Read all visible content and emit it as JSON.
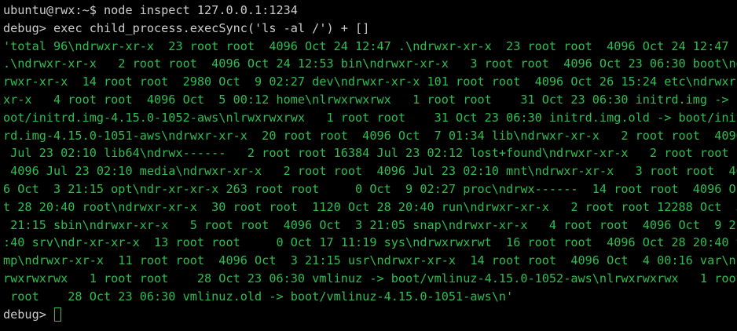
{
  "terminal": {
    "shell_prompt": "ubuntu@rwx:~$ ",
    "shell_command": "node inspect 127.0.0.1:1234",
    "debug_prompt": "debug> ",
    "debug_command": "exec child_process.execSync('ls -al /') + []",
    "output_lines": [
      "'total 96\\ndrwxr-xr-x  23 root root  4096 Oct 24 12:47 .\\ndrwxr-xr-x  23 root root  4096 Oct 24 12:47 .",
      ".\\ndrwxr-xr-x   2 root root  4096 Oct 24 12:53 bin\\ndrwxr-xr-x   3 root root  4096 Oct 23 06:30 boot\\nd",
      "rwxr-xr-x  14 root root  2980 Oct  9 02:27 dev\\ndrwxr-xr-x 101 root root  4096 Oct 26 15:24 etc\\ndrwxr-",
      "xr-x   4 root root  4096 Oct  5 00:12 home\\nlrwxrwxrwx   1 root root    31 Oct 23 06:30 initrd.img -> b",
      "oot/initrd.img-4.15.0-1052-aws\\nlrwxrwxrwx   1 root root    31 Oct 23 06:30 initrd.img.old -> boot/init",
      "rd.img-4.15.0-1051-aws\\ndrwxr-xr-x  20 root root  4096 Oct  7 01:34 lib\\ndrwxr-xr-x   2 root root  4096",
      " Jul 23 02:10 lib64\\ndrwx------   2 root root 16384 Jul 23 02:12 lost+found\\ndrwxr-xr-x   2 root root ",
      " 4096 Jul 23 02:10 media\\ndrwxr-xr-x   2 root root  4096 Jul 23 02:10 mnt\\ndrwxr-xr-x   3 root root  409",
      "6 Oct  3 21:15 opt\\ndr-xr-xr-x 263 root root     0 Oct  9 02:27 proc\\ndrwx------  14 root root  4096 Oc",
      "t 28 20:40 root\\ndrwxr-xr-x  30 root root  1120 Oct 28 20:40 run\\ndrwxr-xr-x   2 root root 12288 Oct  3",
      " 21:15 sbin\\ndrwxr-xr-x   5 root root  4096 Oct  3 21:05 snap\\ndrwxr-xr-x   4 root root  4096 Oct  9 21",
      ":40 srv\\ndr-xr-xr-x  13 root root     0 Oct 17 11:19 sys\\ndrwxrwxrwt  16 root root  4096 Oct 28 20:40 t",
      "mp\\ndrwxr-xr-x  11 root root  4096 Oct  3 21:15 usr\\ndrwxr-xr-x  14 root root  4096 Oct  4 00:16 var\\nl",
      "rwxrwxrwx   1 root root    28 Oct 23 06:30 vmlinuz -> boot/vmlinuz-4.15.0-1052-aws\\nlrwxrwxrwx   1 root",
      " root    28 Oct 23 06:30 vmlinuz.old -> boot/vmlinuz-4.15.0-1051-aws\\n'"
    ],
    "final_prompt": "debug> "
  },
  "colors": {
    "background": "#000000",
    "text": "#cccccc",
    "string_output": "#2ebd4e",
    "cursor": "#2ebd4e"
  }
}
